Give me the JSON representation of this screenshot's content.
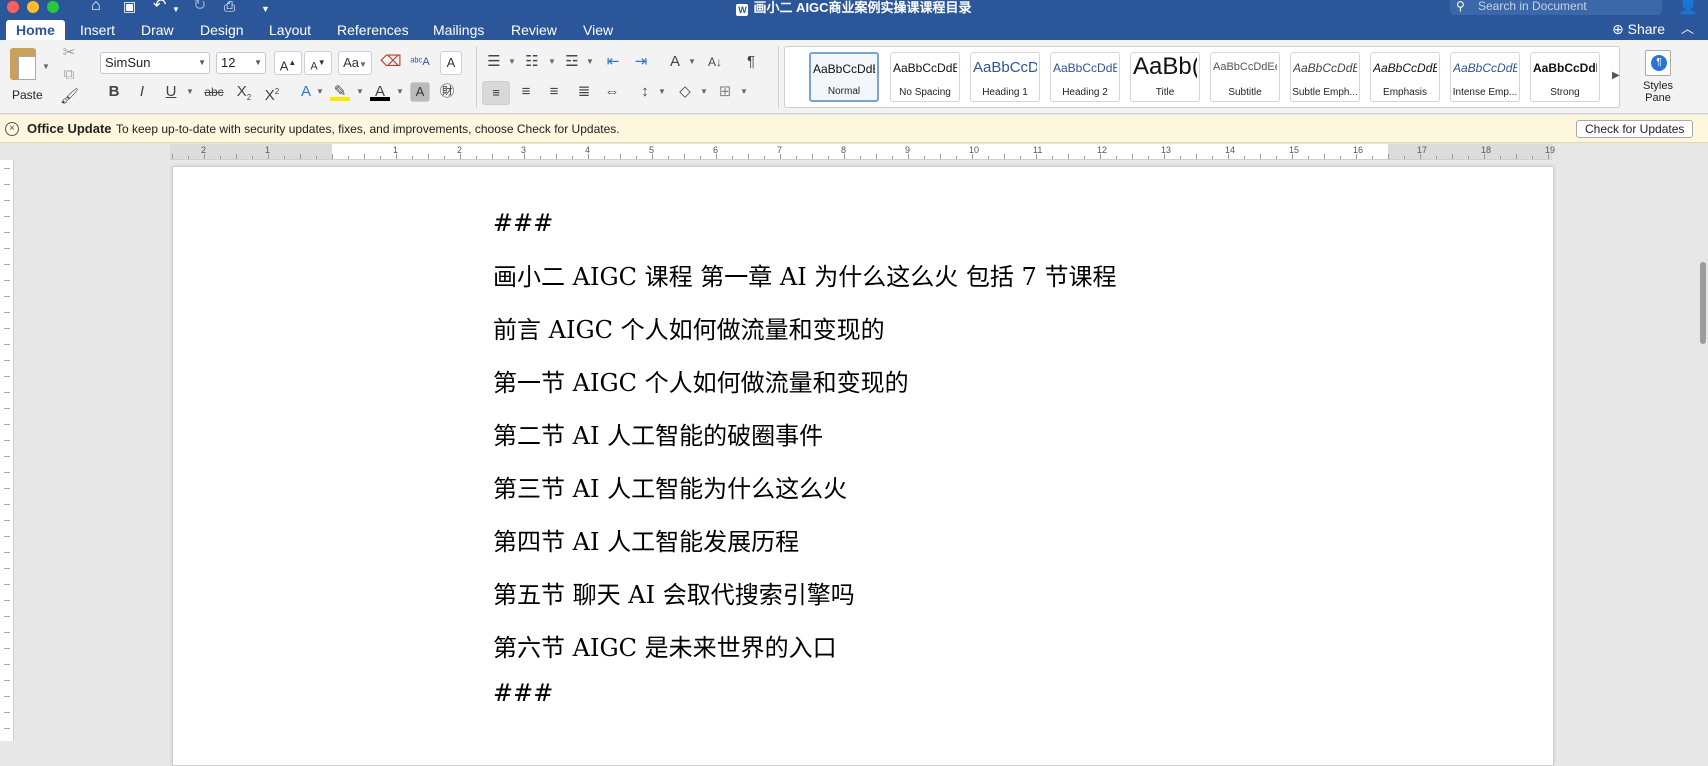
{
  "window": {
    "title": "画小二 AIGC商业案例实操课课程目录",
    "search_placeholder": "Search in Document"
  },
  "tabs": [
    {
      "label": "Home"
    },
    {
      "label": "Insert"
    },
    {
      "label": "Draw"
    },
    {
      "label": "Design"
    },
    {
      "label": "Layout"
    },
    {
      "label": "References"
    },
    {
      "label": "Mailings"
    },
    {
      "label": "Review"
    },
    {
      "label": "View"
    }
  ],
  "share_label": "Share",
  "ribbon": {
    "paste_label": "Paste",
    "font_name": "SimSun",
    "font_size": "12",
    "styles_pane_label": "Styles Pane"
  },
  "styles": [
    {
      "preview": "AaBbCcDdEe",
      "name": "Normal"
    },
    {
      "preview": "AaBbCcDdEe",
      "name": "No Spacing"
    },
    {
      "preview": "AaBbCcDc",
      "name": "Heading 1"
    },
    {
      "preview": "AaBbCcDdEe",
      "name": "Heading 2"
    },
    {
      "preview": "AaBb(",
      "name": "Title"
    },
    {
      "preview": "AaBbCcDdEe",
      "name": "Subtitle"
    },
    {
      "preview": "AaBbCcDdEe",
      "name": "Subtle Emph..."
    },
    {
      "preview": "AaBbCcDdEe",
      "name": "Emphasis"
    },
    {
      "preview": "AaBbCcDdEe",
      "name": "Intense Emp..."
    },
    {
      "preview": "AaBbCcDdEe",
      "name": "Strong"
    }
  ],
  "message_bar": {
    "title": "Office Update",
    "text": "To keep up-to-date with security updates, fixes, and improvements, choose Check for Updates.",
    "button": "Check for Updates"
  },
  "ruler": {
    "numbers": [
      "2",
      "1",
      "1",
      "2",
      "3",
      "4",
      "5",
      "6",
      "7",
      "8",
      "9",
      "10",
      "11",
      "12",
      "13",
      "14",
      "15",
      "16",
      "17",
      "18",
      "19"
    ]
  },
  "document": {
    "paragraphs": [
      "###",
      "画小二 AIGC 课程 第一章 AI 为什么这么火 包括 7 节课程",
      "前言 AIGC 个人如何做流量和变现的",
      "第一节 AIGC 个人如何做流量和变现的",
      "第二节 AI 人工智能的破圈事件",
      "第三节 AI 人工智能为什么这么火",
      "第四节 AI 人工智能发展历程",
      "第五节 聊天 AI 会取代搜索引擎吗",
      "第六节 AIGC 是未来世界的入口",
      "###"
    ]
  },
  "colors": {
    "title_bar": "#2b579a",
    "ribbon": "#f3f3f3",
    "message_bar": "#fcf7dd"
  }
}
